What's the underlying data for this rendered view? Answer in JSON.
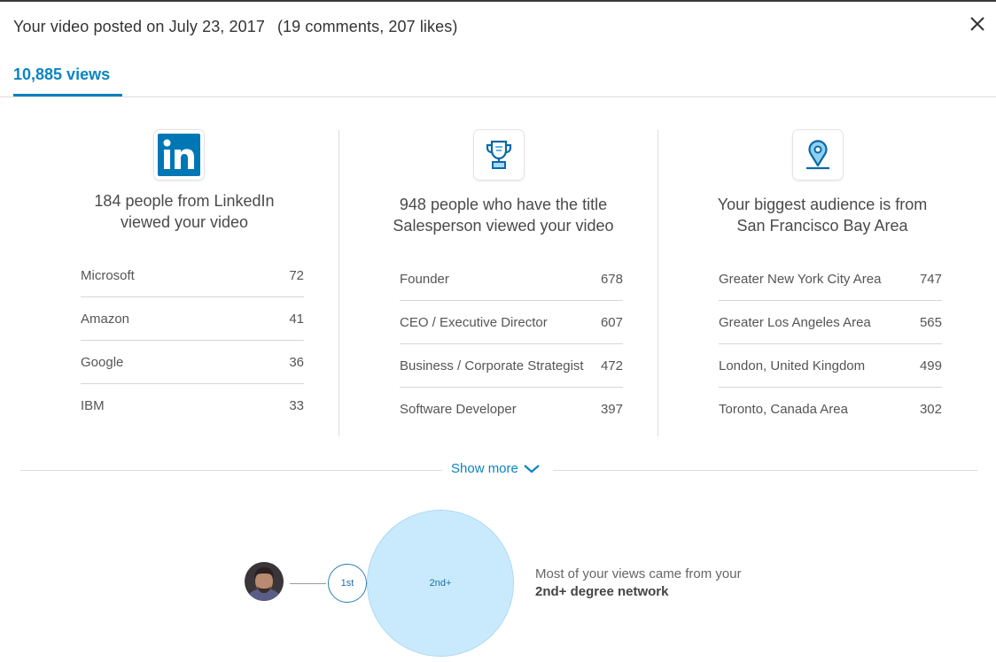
{
  "header": {
    "title": "Your video posted on July 23, 2017",
    "meta": "(19 comments, 207 likes)",
    "close_icon": "close-icon"
  },
  "tabs": [
    {
      "label": "10,885 views",
      "active": true
    }
  ],
  "colors": {
    "accent": "#0a84c1",
    "linkedin_blue": "#0077b5",
    "bubble_fill": "#c9eafc"
  },
  "columns": [
    {
      "icon": "linkedin-logo-icon",
      "headline_line1": "184 people from LinkedIn",
      "headline_line2": "viewed your video",
      "items": [
        {
          "label": "Microsoft",
          "value": "72"
        },
        {
          "label": "Amazon",
          "value": "41"
        },
        {
          "label": "Google",
          "value": "36"
        },
        {
          "label": "IBM",
          "value": "33"
        }
      ]
    },
    {
      "icon": "trophy-icon",
      "headline_line1": "948 people who have the title",
      "headline_line2": "Salesperson viewed your video",
      "items": [
        {
          "label": "Founder",
          "value": "678"
        },
        {
          "label": "CEO / Executive Director",
          "value": "607"
        },
        {
          "label": "Business / Corporate Strategist",
          "value": "472"
        },
        {
          "label": "Software Developer",
          "value": "397"
        }
      ]
    },
    {
      "icon": "location-pin-icon",
      "headline_line1": "Your biggest audience is from",
      "headline_line2": "San Francisco Bay Area",
      "items": [
        {
          "label": "Greater New York City Area",
          "value": "747"
        },
        {
          "label": "Greater Los Angeles Area",
          "value": "565"
        },
        {
          "label": "London, United Kingdom",
          "value": "499"
        },
        {
          "label": "Toronto, Canada Area",
          "value": "302"
        }
      ]
    }
  ],
  "show_more": {
    "label": "Show more"
  },
  "network": {
    "first_label": "1st",
    "second_label": "2nd+",
    "text_line1": "Most of your views came from your",
    "text_line2": "2nd+ degree network"
  }
}
